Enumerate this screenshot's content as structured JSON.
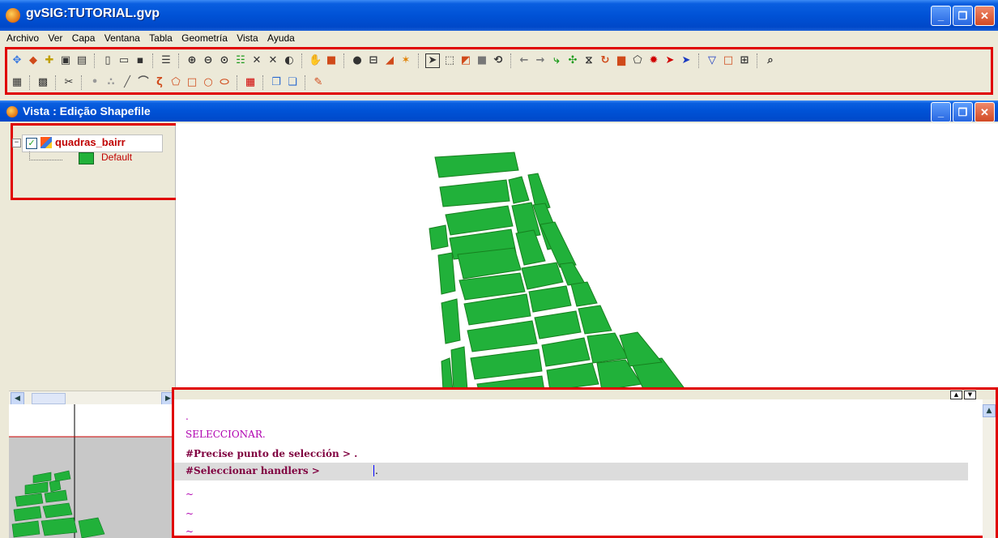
{
  "window": {
    "title": "gvSIG:TUTORIAL.gvp",
    "controls": [
      "_",
      "❐",
      "✕"
    ]
  },
  "menu": [
    "Archivo",
    "Ver",
    "Capa",
    "Ventana",
    "Tabla",
    "Geometría",
    "Vista",
    "Ayuda"
  ],
  "view_window": {
    "title": "Vista : Edição Shapefile"
  },
  "toc": {
    "expander": "−",
    "layer_name": "quadras_bairr",
    "legend_label": "Default",
    "layer_color": "#21b13a"
  },
  "console": {
    "lines": [
      {
        "text": ".",
        "style": "magenta"
      },
      {
        "text": "SELECCIONAR.",
        "style": "magenta"
      },
      {
        "text": "#Precise punto de selección > .",
        "style": "bold"
      },
      {
        "text": "#Seleccionar handlers > ",
        "style": "bold"
      },
      {
        "text": "~",
        "style": "magenta"
      },
      {
        "text": "~",
        "style": "magenta"
      },
      {
        "text": "~",
        "style": "magenta"
      }
    ]
  },
  "colors": {
    "accent_outline": "#e00000",
    "title_bar": "#0052d6",
    "polygon_fill": "#21b13a"
  },
  "toolbar_icons_row1": [
    "add-layer-icon",
    "add-event-layer-icon",
    "locator-icon",
    "save-image-icon",
    "overview-icon",
    "new-icon",
    "open-icon",
    "save-icon",
    "layers-icon",
    "zoom-in-icon",
    "zoom-out-icon",
    "zoom-previous-icon",
    "full-extent-icon",
    "zoom-select-icon",
    "zoom-layer-icon",
    "measure-icon",
    "pan-icon",
    "frame-icon",
    "info-icon",
    "measure-distance-icon",
    "measure-area-icon",
    "hyperlink-icon",
    "select-icon",
    "select-rect-icon",
    "select-poly-icon",
    "select-all-icon",
    "invert-select-icon",
    "undo-icon",
    "redo-icon",
    "edit-vertex-icon",
    "move-icon",
    "mirror-icon",
    "rotate-icon",
    "stretch-icon",
    "polygon-icon",
    "explode-icon",
    "pointer-icon",
    "pointer-alt-icon",
    "filter-icon",
    "rectangle-icon",
    "label-icon",
    "zoom-box-icon"
  ],
  "toolbar_icons_row2": [
    "table-icon",
    "grid-icon",
    "tools-icon",
    "point-icon",
    "multipoint-icon",
    "line-icon",
    "arc-icon",
    "polyline-icon",
    "polygon-draw-icon",
    "rectangle-draw-icon",
    "circle-icon",
    "ellipse-icon",
    "table-edit-icon",
    "copy-icon",
    "paste-icon",
    "annotation-icon"
  ]
}
